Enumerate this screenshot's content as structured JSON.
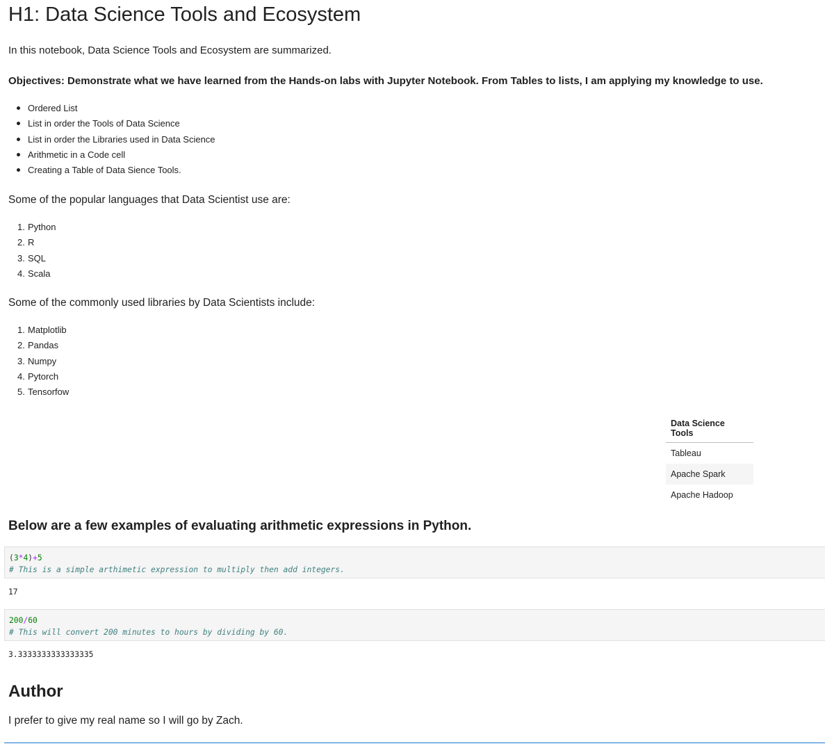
{
  "notebook": {
    "title": "H1: Data Science Tools and Ecosystem",
    "intro": "In this notebook, Data Science Tools and Ecosystem are summarized.",
    "objectives": "Objectives: Demonstrate what we have learned from the Hands-on labs with Jupyter Notebook. From Tables to lists, I am applying my knowledge to use.",
    "objective_items": [
      "Ordered List",
      "List in order the Tools of Data Science",
      "List in order the Libraries used in Data Science",
      "Arithmetic in a Code cell",
      "Creating a Table of Data Sience Tools."
    ],
    "languages_intro": "Some of the popular languages that Data Scientist use are:",
    "languages": [
      "Python",
      "R",
      "SQL",
      "Scala"
    ],
    "libraries_intro": "Some of the commonly used libraries by Data Scientists include:",
    "libraries": [
      "Matplotlib",
      "Pandas",
      "Numpy",
      "Pytorch",
      "Tensorfow"
    ],
    "tools_table": {
      "header": "Data Science Tools",
      "rows": [
        "Tableau",
        "Apache Spark",
        "Apache Hadoop"
      ]
    },
    "examples_heading": "Below are a few examples of evaluating arithmetic expressions in Python.",
    "cells": [
      {
        "code": {
          "p1": "(",
          "n1": "3",
          "op1": "*",
          "n2": "4",
          "p2": ")",
          "op2": "+",
          "n3": "5"
        },
        "comment": "# This is a simple arthimetic expression to multiply then add integers.",
        "output": "17"
      },
      {
        "code": {
          "n1": "200",
          "op1": "/",
          "n2": "60"
        },
        "comment": "# This will convert 200 minutes to hours by dividing by 60.",
        "output": "3.3333333333333335"
      }
    ],
    "author_heading": "Author",
    "author_text": "I prefer to give my real name so I will go by Zach."
  },
  "colors": {
    "code_number": "#008000",
    "code_operator": "#aa22ff",
    "code_comment": "#408080",
    "cell_background": "#f5f5f5",
    "selection": "#1976d2"
  }
}
